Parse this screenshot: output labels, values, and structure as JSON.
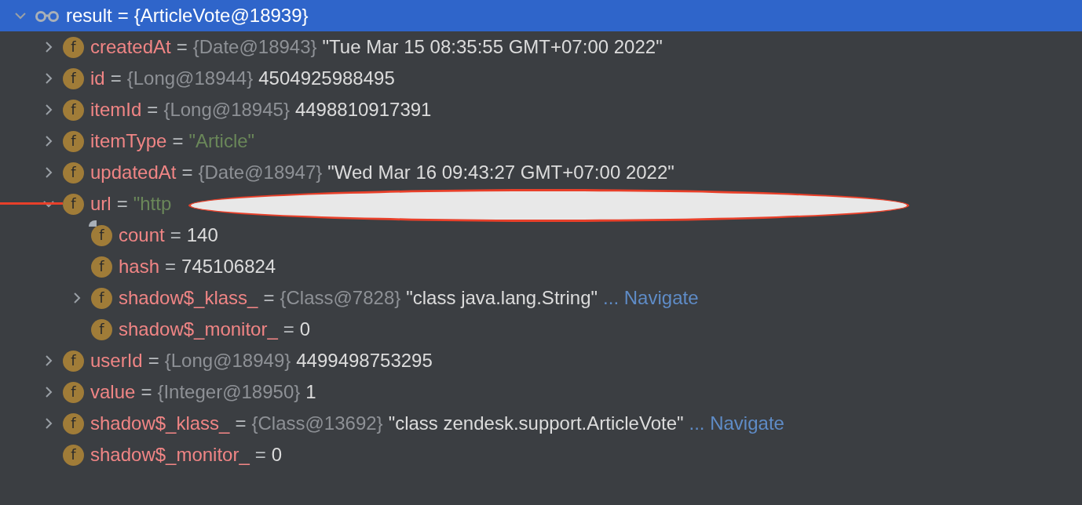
{
  "tree": [
    {
      "kind": "root",
      "name": "result",
      "sep": "=",
      "selected": true,
      "expanded": true,
      "type_ref": "{ArticleVote@18939}",
      "children": [
        {
          "kind": "field",
          "icon": "f",
          "name": "createdAt",
          "sep": "=",
          "selected": false,
          "expanded": false,
          "type_ref": "{Date@18943}",
          "value": "\"Tue Mar 15 08:35:55 GMT+07:00 2022\"",
          "is_string": false
        },
        {
          "kind": "field",
          "icon": "f",
          "name": "id",
          "sep": "=",
          "selected": false,
          "expanded": false,
          "type_ref": "{Long@18944}",
          "value": "4504925988495",
          "is_string": false
        },
        {
          "kind": "field",
          "icon": "f",
          "name": "itemId",
          "sep": "=",
          "selected": false,
          "expanded": false,
          "type_ref": "{Long@18945}",
          "value": "4498810917391",
          "is_string": false
        },
        {
          "kind": "field",
          "icon": "f",
          "name": "itemType",
          "sep": "=",
          "selected": false,
          "expanded": false,
          "value": "\"Article\"",
          "is_string": true
        },
        {
          "kind": "field",
          "icon": "f",
          "name": "updatedAt",
          "sep": "=",
          "selected": false,
          "expanded": false,
          "type_ref": "{Date@18947}",
          "value": "\"Wed Mar 16 09:43:27 GMT+07:00 2022\"",
          "is_string": false
        },
        {
          "kind": "field",
          "icon": "f",
          "name": "url",
          "sep": "=",
          "selected": false,
          "expanded": true,
          "value": "\"http",
          "is_string": true,
          "redacted": true,
          "children": [
            {
              "kind": "field",
              "icon": "f",
              "name": "count",
              "sep": "=",
              "selected": false,
              "value": "140",
              "is_string": false,
              "marked": true
            },
            {
              "kind": "field",
              "icon": "f",
              "name": "hash",
              "sep": "=",
              "selected": false,
              "value": "745106824",
              "is_string": false
            },
            {
              "kind": "field",
              "icon": "f",
              "name": "shadow$_klass_",
              "sep": "=",
              "selected": false,
              "expanded": false,
              "type_ref": "{Class@7828}",
              "value": "\"class java.lang.String\"",
              "is_string": false,
              "link": "... Navigate"
            },
            {
              "kind": "field",
              "icon": "f",
              "name": "shadow$_monitor_",
              "sep": "=",
              "selected": false,
              "value": "0",
              "is_string": false
            }
          ]
        },
        {
          "kind": "field",
          "icon": "f",
          "name": "userId",
          "sep": "=",
          "selected": false,
          "expanded": false,
          "type_ref": "{Long@18949}",
          "value": "4499498753295",
          "is_string": false
        },
        {
          "kind": "field",
          "icon": "f",
          "name": "value",
          "sep": "=",
          "selected": false,
          "expanded": false,
          "type_ref": "{Integer@18950}",
          "value": "1",
          "is_string": false
        },
        {
          "kind": "field",
          "icon": "f",
          "name": "shadow$_klass_",
          "sep": "=",
          "selected": false,
          "expanded": false,
          "type_ref": "{Class@13692}",
          "value": "\"class zendesk.support.ArticleVote\"",
          "is_string": false,
          "link": "... Navigate"
        },
        {
          "kind": "field",
          "icon": "f",
          "name": "shadow$_monitor_",
          "sep": "=",
          "selected": false,
          "value": "0",
          "is_string": false
        }
      ]
    }
  ]
}
